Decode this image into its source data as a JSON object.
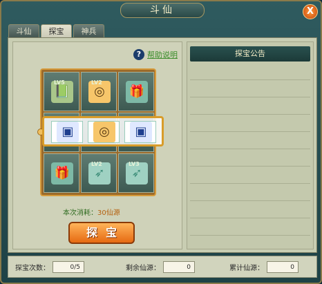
{
  "window": {
    "title": "斗仙",
    "close_label": "X"
  },
  "tabs": [
    {
      "label": "斗仙"
    },
    {
      "label": "探宝"
    },
    {
      "label": "神兵"
    }
  ],
  "left": {
    "help_icon": "?",
    "help_text": "帮助说明",
    "grid": {
      "row1": [
        {
          "icon": "book-icon",
          "glyph": "📗",
          "lv": "LV5"
        },
        {
          "icon": "ring-icon",
          "glyph": "◎",
          "lv": "LV2"
        },
        {
          "icon": "gift-icon",
          "glyph": "🎁",
          "lv": ""
        }
      ],
      "row2": [
        {
          "icon": "box-icon",
          "glyph": "▣",
          "lv": ""
        },
        {
          "icon": "ring-item-icon",
          "glyph": "◎",
          "lv": ""
        },
        {
          "icon": "box-icon",
          "glyph": "▣",
          "lv": ""
        }
      ],
      "row3": [
        {
          "icon": "gift-icon",
          "glyph": "🎁",
          "lv": ""
        },
        {
          "icon": "feather-icon",
          "glyph": "➶",
          "lv": "LV2"
        },
        {
          "icon": "feather-icon",
          "glyph": "➶",
          "lv": "LV3"
        }
      ]
    },
    "cost_label": "本次消耗：",
    "cost_value": "30仙源",
    "explore_button": "探宝"
  },
  "right": {
    "header": "探宝公告"
  },
  "footer": {
    "tries_label": "探宝次数：",
    "tries_value": "0/5",
    "remain_label": "剩余仙源：",
    "remain_value": "0",
    "total_label": "累计仙源：",
    "total_value": "0"
  },
  "colors": {
    "accent_gold": "#d89c2a",
    "help_green": "#3b8d2a",
    "button_orange": "#e66a12"
  }
}
